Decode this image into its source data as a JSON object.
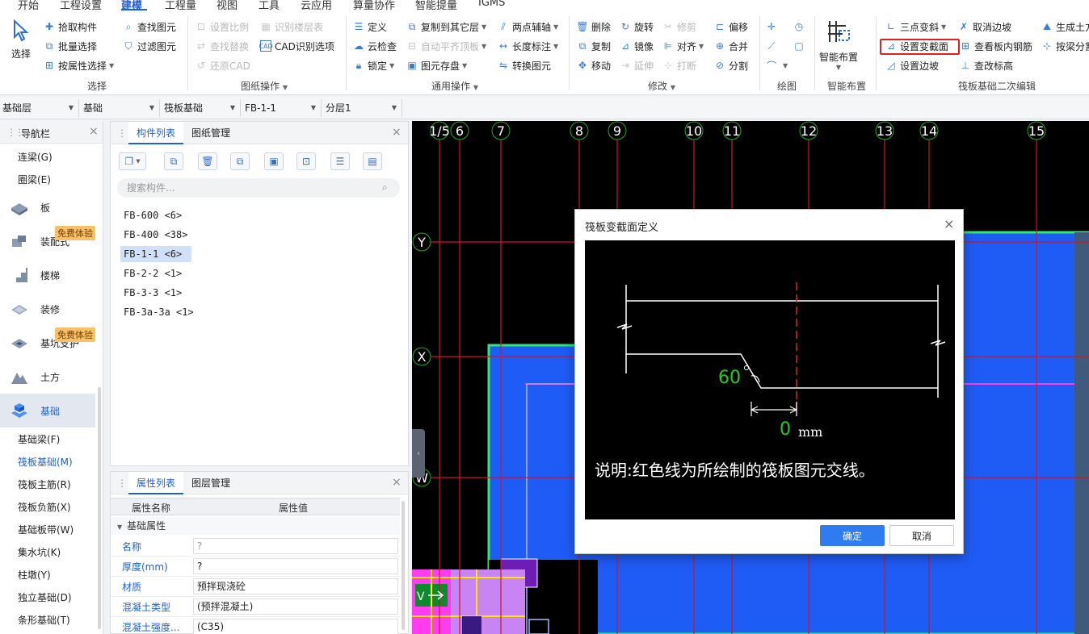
{
  "menu": {
    "items": [
      "开始",
      "工程设置",
      "建模",
      "工程量",
      "视图",
      "工具",
      "云应用",
      "算量协作",
      "智能提量",
      "IGMS"
    ],
    "active_index": 2
  },
  "ribbon": {
    "select_group": {
      "big_label": "选择",
      "items": [
        "拾取构件",
        "批量选择",
        "按属性选择",
        "查找图元",
        "过滤图元"
      ],
      "label": "选择"
    },
    "drawing_group": {
      "items": [
        "设置比例",
        "识别楼层表",
        "查找替换",
        "CAD识别选项",
        "还原CAD"
      ],
      "label": "图纸操作"
    },
    "common_group": {
      "items": [
        "定义",
        "复制到其它层",
        "两点辅轴",
        "云检查",
        "自动平齐顶板",
        "长度标注",
        "锁定",
        "图元存盘",
        "转换图元"
      ],
      "label": "通用操作"
    },
    "modify_group": {
      "items": [
        "删除",
        "旋转",
        "修剪",
        "偏移",
        "复制",
        "镜像",
        "对齐",
        "合并",
        "移动",
        "延伸",
        "打断",
        "分割"
      ],
      "label": "修改"
    },
    "draw_group": {
      "label": "绘图"
    },
    "smart_group": {
      "big_label": "智能布置",
      "label": "智能布置"
    },
    "raft_group": {
      "items": [
        "三点变斜",
        "取消边坡",
        "生成土方",
        "设置变截面",
        "查看板内钢筋",
        "按梁分割",
        "设置边坡",
        "查改标高"
      ],
      "label": "筏板基础二次编辑",
      "highlighted": "设置变截面"
    }
  },
  "layerbar": {
    "selects": [
      "基础层",
      "基础",
      "筏板基础",
      "FB-1-1",
      "分层1"
    ]
  },
  "nav": {
    "title": "导航栏",
    "top_items": [
      "连梁(G)",
      "圈梁(E)"
    ],
    "categories": [
      "板",
      "装配式",
      "楼梯",
      "装修",
      "基坑支护",
      "土方",
      "基础"
    ],
    "badge_text": "免费体验",
    "active_category": "基础",
    "sub_items": [
      "基础梁(F)",
      "筏板基础(M)",
      "筏板主筋(R)",
      "筏板负筋(X)",
      "基础板带(W)",
      "集水坑(K)",
      "柱墩(Y)",
      "独立基础(D)",
      "条形基础(T)"
    ],
    "active_sub": "筏板基础(M)"
  },
  "components": {
    "tabs": [
      "构件列表",
      "图纸管理"
    ],
    "search_placeholder": "搜索构件...",
    "items": [
      "FB-600 <6>",
      "FB-400 <38>",
      "FB-1-1 <6>",
      "FB-2-2 <1>",
      "FB-3-3 <1>",
      "FB-3a-3a <1>"
    ],
    "active_item": "FB-1-1 <6>"
  },
  "properties": {
    "tabs": [
      "属性列表",
      "图层管理"
    ],
    "col_name": "属性名称",
    "col_value": "属性值",
    "group": "基础属性",
    "rows": [
      {
        "name": "名称",
        "value": "?"
      },
      {
        "name": "厚度(mm)",
        "value": "?"
      },
      {
        "name": "材质",
        "value": "预拌现浇砼"
      },
      {
        "name": "混凝土类型",
        "value": "(预拌混凝土)"
      },
      {
        "name": "混凝土强度...",
        "value": "(C35)"
      }
    ]
  },
  "canvas": {
    "axis_top": [
      "1/5",
      "6",
      "7",
      "8",
      "9",
      "10",
      "11",
      "12",
      "13",
      "14",
      "15"
    ],
    "axis_left": [
      "Y",
      "X",
      "W",
      "V"
    ]
  },
  "dialog": {
    "title": "筏板变截面定义",
    "angle": "60",
    "offset_value": "0",
    "offset_unit": "mm",
    "note": "说明:红色线为所绘制的筏板图元交线。",
    "ok": "确定",
    "cancel": "取消"
  },
  "colors": {
    "accent": "#1e5fd6",
    "highlight_box": "#e02020",
    "raft_fill": "#1f5cf5",
    "grid_line": "#d4142a",
    "dialog_green": "#22cc22"
  }
}
